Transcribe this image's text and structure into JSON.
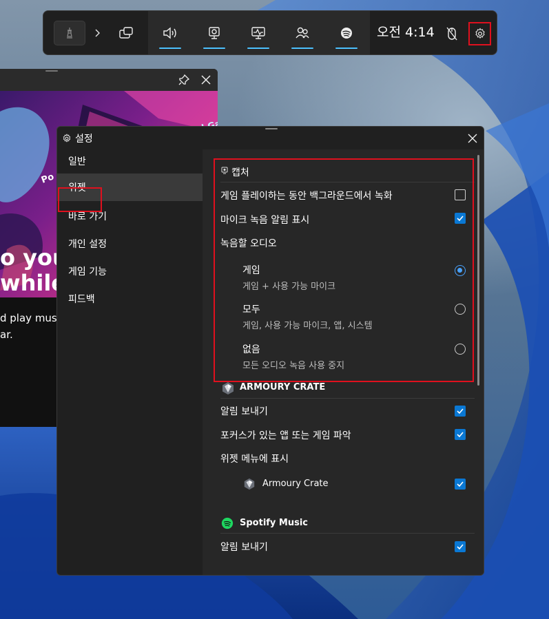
{
  "gamebar": {
    "time": "오전 4:14",
    "buttons": [
      "audio-icon",
      "capture-icon",
      "performance-icon",
      "xbox-social-icon",
      "spotify-icon"
    ]
  },
  "background_widget": {
    "line1": "o your",
    "line2": "while",
    "sub1": "d play music",
    "sub2": "ar.",
    "art_text1": "Pixel Ga",
    "art_text2": "Po"
  },
  "settings": {
    "title": "설정",
    "nav": [
      "일반",
      "위젯",
      "바로 가기",
      "개인 설정",
      "게임 기능",
      "피드백"
    ],
    "active_nav": "위젯",
    "capture": {
      "header": "캡처",
      "bg_record_label": "게임 플레이하는 동안 백그라운드에서 녹화",
      "mic_notify_label": "마이크 녹음 알림 표시",
      "audio_label": "녹음할 오디오",
      "opt_game": "게임",
      "opt_game_sub": "게임 + 사용 가능 마이크",
      "opt_all": "모두",
      "opt_all_sub": "게임, 사용 가능 마이크, 앱, 시스템",
      "opt_none": "없음",
      "opt_none_sub": "모든 오디오 녹음 사용 중지"
    },
    "armoury": {
      "header": "ARMOURY CRATE",
      "notify_label": "알림 보내기",
      "focus_label": "포커스가 있는 앱 또는 게임 파악",
      "menu_label": "위젯 메뉴에 표시",
      "app_label": "Armoury Crate"
    },
    "spotify": {
      "header": "Spotify Music",
      "notify_label": "알림 보내기"
    }
  },
  "colors": {
    "accent": "#0a78d4",
    "highlight": "#e0101e"
  }
}
